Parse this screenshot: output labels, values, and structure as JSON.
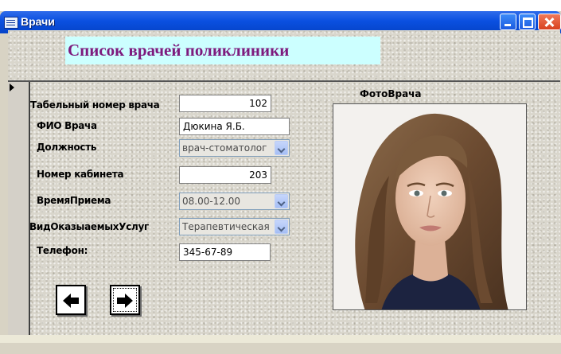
{
  "window": {
    "title": "Врачи"
  },
  "form": {
    "title": "Список врачей поликлиники",
    "photo_label": "ФотоВрача",
    "photo_icon": "doctor-photo"
  },
  "fields": {
    "tab_number": {
      "label": "Табельный номер врача",
      "value": "102"
    },
    "full_name": {
      "label": "ФИО Врача",
      "value": "Дюкина Я.Б."
    },
    "position": {
      "label": "Должность",
      "value": "врач-стоматолог"
    },
    "room": {
      "label": "Номер кабинета",
      "value": "203"
    },
    "reception_time": {
      "label": "ВремяПриема",
      "value": "08.00-12.00"
    },
    "service_type": {
      "label": "ВидОказыаемыхУслуг",
      "value": "Терапевтическая"
    },
    "phone": {
      "label": "Телефон:",
      "value": "345-67-89"
    }
  },
  "nav": {
    "prev_icon": "arrow-left-icon",
    "next_icon": "arrow-right-icon"
  }
}
